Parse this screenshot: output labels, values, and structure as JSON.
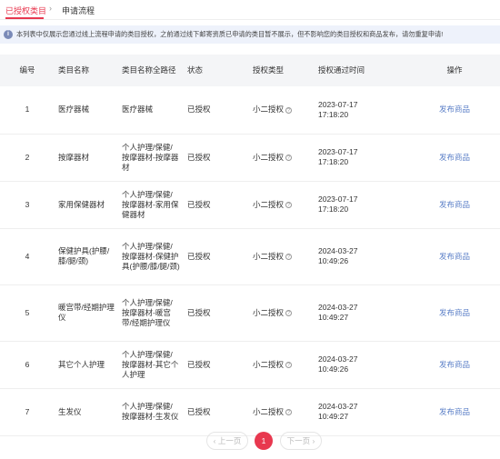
{
  "tabs": {
    "active": "已授权类目",
    "separator": "›",
    "other": "申请流程"
  },
  "notice": {
    "icon": "i",
    "text": "本列表中仅展示您通过线上流程申请的类目授权，之前通过线下邮寄资质已申请的类目暂不展示，但不影响您的类目授权和商品发布，请勿重复申请!"
  },
  "table": {
    "headers": {
      "no": "编号",
      "name": "类目名称",
      "path": "类目名称全路径",
      "status": "状态",
      "type": "授权类型",
      "time": "授权通过时间",
      "op": "操作"
    },
    "rows": [
      {
        "no": "1",
        "name": "医疗器械",
        "path": "医疗器械",
        "status": "已授权",
        "type": "小二授权",
        "date": "2023-07-17",
        "time": "17:18:20",
        "op": "发布商品"
      },
      {
        "no": "2",
        "name": "按摩器材",
        "path": "个人护理/保健/按摩器材-按摩器材",
        "status": "已授权",
        "type": "小二授权",
        "date": "2023-07-17",
        "time": "17:18:20",
        "op": "发布商品"
      },
      {
        "no": "3",
        "name": "家用保健器材",
        "path": "个人护理/保健/按摩器材-家用保健器材",
        "status": "已授权",
        "type": "小二授权",
        "date": "2023-07-17",
        "time": "17:18:20",
        "op": "发布商品"
      },
      {
        "no": "4",
        "name": "保健护具(护腰/膝/腿/颈)",
        "path": "个人护理/保健/按摩器材-保健护具(护腰/膝/腿/颈)",
        "status": "已授权",
        "type": "小二授权",
        "date": "2024-03-27",
        "time": "10:49:26",
        "op": "发布商品"
      },
      {
        "no": "5",
        "name": "暖宫带/经期护理仪",
        "path": "个人护理/保健/按摩器材-暖宫带/经期护理仪",
        "status": "已授权",
        "type": "小二授权",
        "date": "2024-03-27",
        "time": "10:49:27",
        "op": "发布商品"
      },
      {
        "no": "6",
        "name": "其它个人护理",
        "path": "个人护理/保健/按摩器材-其它个人护理",
        "status": "已授权",
        "type": "小二授权",
        "date": "2024-03-27",
        "time": "10:49:26",
        "op": "发布商品"
      },
      {
        "no": "7",
        "name": "生发仪",
        "path": "个人护理/保健/按摩器材-生发仪",
        "status": "已授权",
        "type": "小二授权",
        "date": "2024-03-27",
        "time": "10:49:27",
        "op": "发布商品"
      }
    ]
  },
  "pager": {
    "prev": "‹ 上一页",
    "current": "1",
    "next": "下一页 ›"
  },
  "colors": {
    "accent": "#e8384f",
    "link": "#5b7fc7",
    "notice_bg": "#eef2fb"
  }
}
